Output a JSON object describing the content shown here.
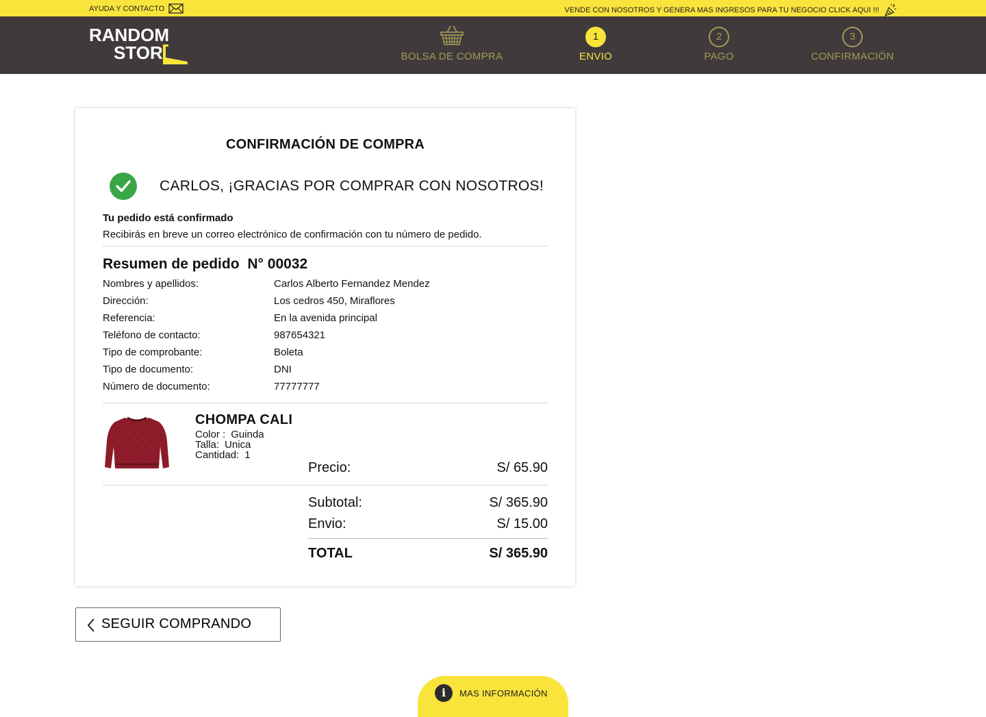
{
  "topbar": {
    "help_label": "AYUDA Y CONTACTO",
    "help_icon": "mail-icon",
    "promo_text": "VENDE CON NOSOTROS Y  GENERA MAS INGRESOS PARA TU NEGOCIO CLICK AQUI !!!",
    "promo_icon": "celebration-icon",
    "background": "#f9e43c"
  },
  "header": {
    "background": "#403a3c",
    "logo": {
      "line1": "RANDOM",
      "line2": "STOR"
    },
    "steps": [
      {
        "number": "",
        "icon": "basket-icon",
        "label": "BOLSA DE COMPRA",
        "active": false
      },
      {
        "number": "1",
        "label": "ENVIO",
        "active": true
      },
      {
        "number": "2",
        "label": "PAGO",
        "active": false
      },
      {
        "number": "3",
        "label": "CONFIRMACIÓN",
        "active": false
      }
    ]
  },
  "card": {
    "title": "CONFIRMACIÓN DE COMPRA",
    "thanks": "CARLOS, ¡GRACIAS POR COMPRAR CON NOSOTROS!",
    "confirmed_title": "Tu pedido está confirmado",
    "confirmed_text": "Recibirás en breve un correo electrónico de confirmación con tu número de pedido.",
    "summary_label": "Resumen de pedido",
    "order_number": "N° 00032",
    "details": [
      {
        "label": "Nombres y apellidos:",
        "value": "Carlos Alberto Fernandez Mendez"
      },
      {
        "label": "Dirección:",
        "value": "Los cedros 450, Miraflores"
      },
      {
        "label": "Referencia:",
        "value": "En la avenida principal"
      },
      {
        "label": "Teléfono de contacto:",
        "value": "987654321"
      },
      {
        "label": "Tipo de comprobante:",
        "value": "Boleta"
      },
      {
        "label": "Tipo de documento:",
        "value": "DNI"
      },
      {
        "label": "Número de documento:",
        "value": "77777777"
      }
    ],
    "product": {
      "name": "CHOMPA CALI",
      "color_label": "Color :",
      "color_value": "Guinda",
      "size_label": "Talla:",
      "size_value": "Unica",
      "qty_label": "Cantidad:",
      "qty_value": "1",
      "price_label": "Precio:",
      "price_value": "S/ 65.90",
      "image_color": "#8c1c2a"
    },
    "totals": {
      "subtotal_label": "Subtotal:",
      "subtotal_value": "S/  365.90",
      "shipping_label": "Envio:",
      "shipping_value": "S/  15.00",
      "total_label": "TOTAL",
      "total_value": "S/  365.90"
    }
  },
  "back_button": {
    "label": "SEGUIR COMPRANDO",
    "icon": "chevron-left-icon"
  },
  "info_tab": {
    "label": "MAS INFORMACIÓN",
    "icon": "info-icon"
  },
  "colors": {
    "accent": "#f9e43c",
    "success": "#3aa648",
    "muted_step": "#a49a56"
  }
}
